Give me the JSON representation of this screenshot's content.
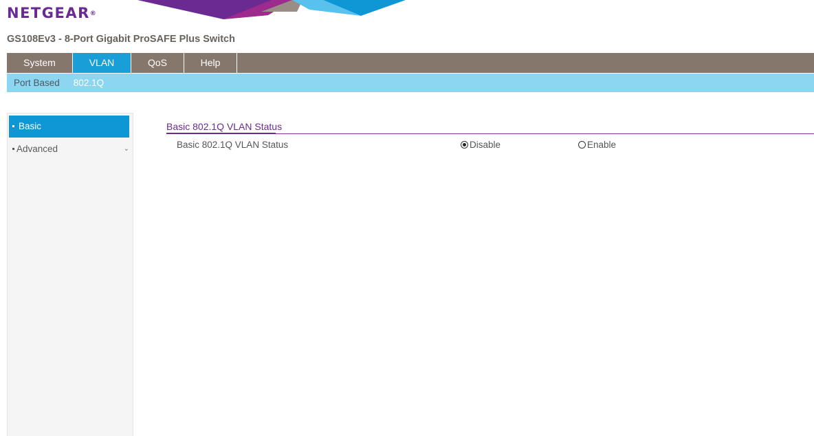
{
  "header": {
    "brand": "NETGEAR",
    "brand_mark": "®",
    "product_title": "GS108Ev3 - 8-Port Gigabit ProSAFE Plus Switch"
  },
  "main_nav": {
    "tabs": [
      {
        "label": "System",
        "active": false
      },
      {
        "label": "VLAN",
        "active": true
      },
      {
        "label": "QoS",
        "active": false
      },
      {
        "label": "Help",
        "active": false
      }
    ]
  },
  "sub_nav": {
    "items": [
      {
        "label": "Port Based",
        "active": false
      },
      {
        "label": "802.1Q",
        "active": true
      }
    ]
  },
  "sidebar": {
    "items": [
      {
        "label": "Basic",
        "active": true
      },
      {
        "label": "Advanced",
        "active": false,
        "expand_icon": "chevron-down-icon"
      }
    ]
  },
  "content": {
    "section_title": "Basic 802.1Q VLAN Status",
    "row_label": "Basic 802.1Q VLAN Status",
    "options": [
      {
        "label": "Disable",
        "checked": true
      },
      {
        "label": "Enable",
        "checked": false
      }
    ]
  },
  "colors": {
    "brand_purple": "#6a2a91",
    "nav_bg": "#86776d",
    "nav_active": "#1a9ed8",
    "subnav_bg": "#8dd6f2",
    "sidebar_active": "#0f97d5"
  }
}
